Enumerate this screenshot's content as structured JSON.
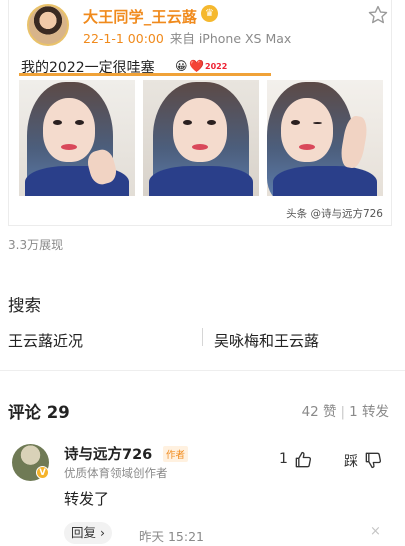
{
  "post": {
    "username": "大王同学_王云蕗",
    "badge_icon": "crown-badge-icon",
    "date": "22-1-1 00:00",
    "source": "来自 iPhone XS Max",
    "text": "我的2022一定很哇塞",
    "emoji_1": "😀",
    "emoji_2": "❤️",
    "tag": "2022",
    "star_icon": "star-outline-icon",
    "photo_count": 3,
    "watermark": "头条 @诗与远方726",
    "accent_color": "#f08a1c"
  },
  "views": "3.3万展现",
  "search": {
    "title": "搜索",
    "links": [
      "王云蕗近况",
      "吴咏梅和王云蕗"
    ]
  },
  "comments": {
    "title": "评论 29",
    "likes": "42 赞",
    "reposts": "1 转发",
    "items": [
      {
        "name": "诗与远方726",
        "tag": "作者",
        "subtitle": "优质体育领域创作者",
        "text": "转发了",
        "like_count": "1",
        "dislike_label": "踩",
        "reply": "回复 ›",
        "time": "昨天  15:21",
        "close": "×"
      }
    ]
  }
}
